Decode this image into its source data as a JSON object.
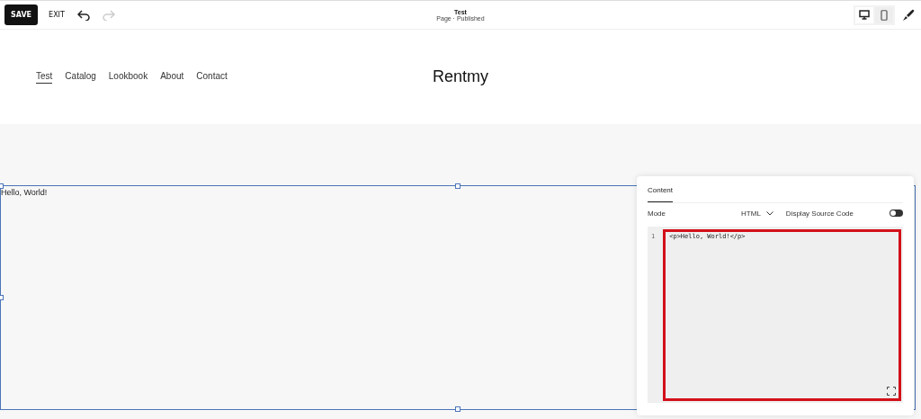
{
  "toolbar": {
    "save": "SAVE",
    "exit": "EXIT",
    "undo_disabled": false,
    "redo_disabled": true
  },
  "page_info": {
    "title": "Test",
    "status": "Page · Published"
  },
  "view_toggle": [
    {
      "kind": "desktop",
      "selected": true
    },
    {
      "kind": "mobile",
      "selected": false
    }
  ],
  "nav": [
    {
      "label": "Test",
      "selected": true
    },
    {
      "label": "Catalog",
      "selected": false
    },
    {
      "label": "Lookbook",
      "selected": false
    },
    {
      "label": "About",
      "selected": false
    },
    {
      "label": "Contact",
      "selected": false
    }
  ],
  "site_title": "Rentmy",
  "block_text": "Hello, World!",
  "panel": {
    "tab": "Content",
    "mode_label": "Mode",
    "mode_value": "HTML",
    "toggle_label": "Display Source Code",
    "toggle_on": false,
    "code_lines": [
      {
        "number": "1",
        "text": "<p>Hello, World!</p>"
      }
    ]
  }
}
